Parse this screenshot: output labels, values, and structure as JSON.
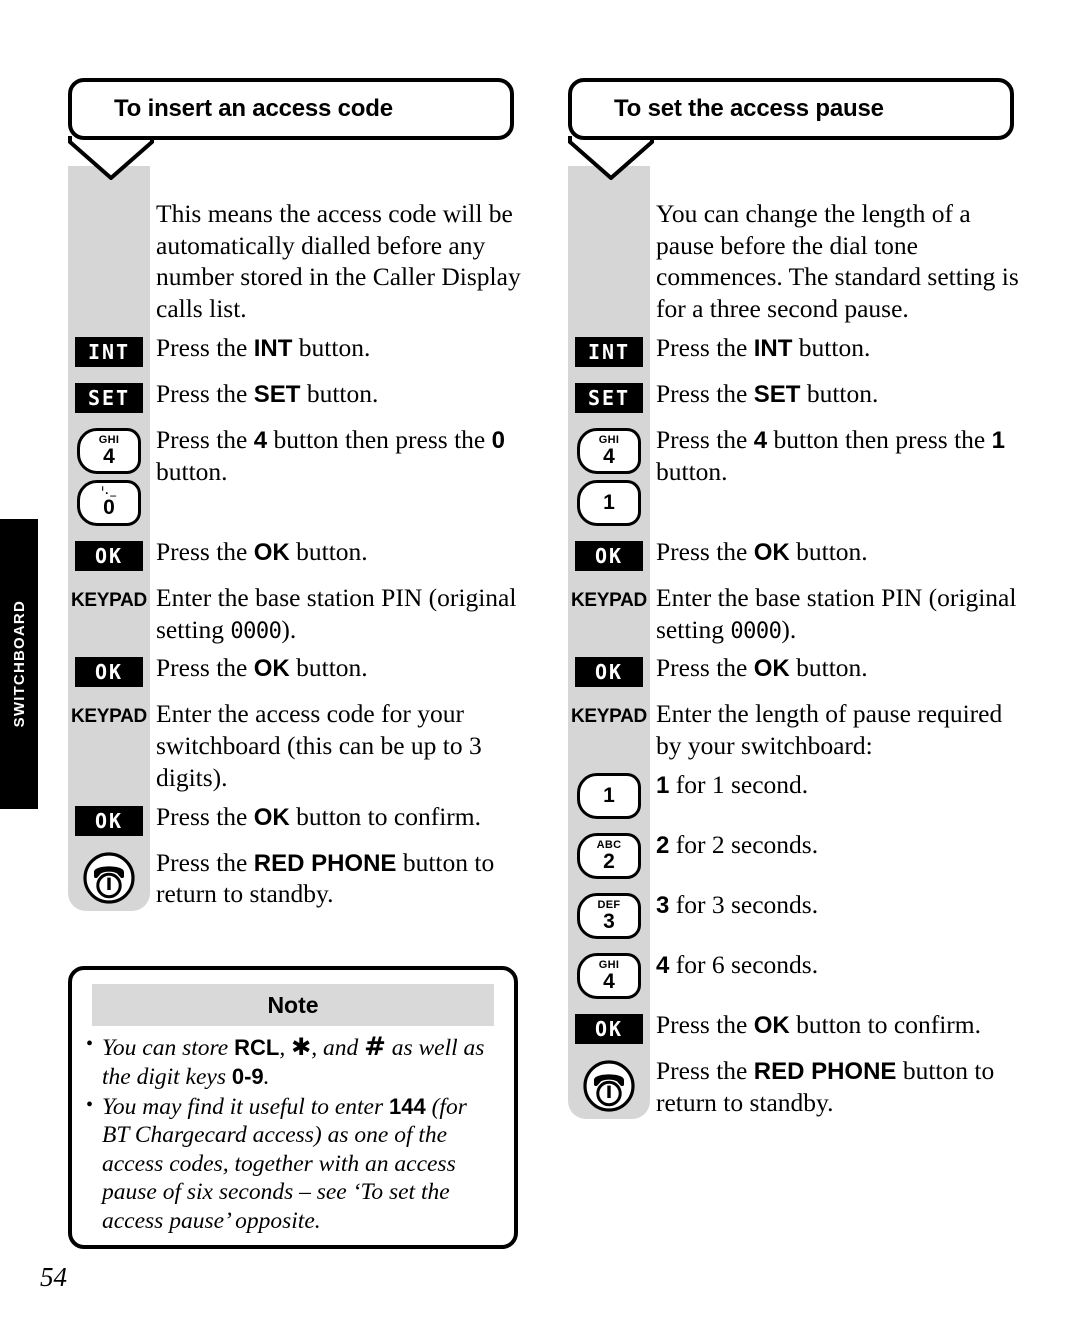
{
  "side_tab": {
    "label": "SWITCHBOARD"
  },
  "page_number": "54",
  "columns": [
    {
      "heading": "To insert an access code",
      "intro": "This means the access code will be automatically dialled before any number stored in the Caller Display calls list.",
      "steps": [
        {
          "icon": "int-button-icon",
          "icon_label": "INT",
          "text_prefix": "Press the ",
          "bold": "INT",
          "text_suffix": " button."
        },
        {
          "icon": "set-button-icon",
          "icon_label": "SET",
          "text_prefix": "Press the ",
          "bold": "SET",
          "text_suffix": " button."
        },
        {
          "icon": "keypad-4-then-0",
          "keys": [
            {
              "sub": "GHI",
              "num": "4"
            },
            {
              "sub": "ᑊ._",
              "num": "0",
              "sub_is_symbol": true
            }
          ],
          "text_prefix": "Press the ",
          "bold": "4",
          "text_mid": " button then press the ",
          "bold2": "0",
          "text_suffix": " button."
        },
        {
          "icon": "ok-button-icon",
          "icon_label": "OK",
          "text_prefix": "Press the ",
          "bold": "OK",
          "text_suffix": " button."
        },
        {
          "icon": "keypad-label",
          "icon_label": "KEYPAD",
          "text_prefix": "Enter the base station PIN (original setting ",
          "mono": "0000",
          "text_suffix": ")."
        },
        {
          "icon": "ok-button-icon",
          "icon_label": "OK",
          "text_prefix": "Press the ",
          "bold": "OK",
          "text_suffix": " button."
        },
        {
          "icon": "keypad-label",
          "icon_label": "KEYPAD",
          "text_prefix": "Enter the access code for your switchboard (this can be up to 3 digits)."
        },
        {
          "icon": "ok-button-icon",
          "icon_label": "OK",
          "text_prefix": "Press the ",
          "bold": "OK",
          "text_suffix": " button to confirm."
        },
        {
          "icon": "red-phone-icon",
          "text_prefix": "Press the ",
          "bold": "RED PHONE",
          "text_suffix": " button to return to standby."
        }
      ]
    },
    {
      "heading": "To set the access pause",
      "intro": "You can change the length of a pause before the dial tone commences. The standard setting is for a three second pause.",
      "steps": [
        {
          "icon": "int-button-icon",
          "icon_label": "INT",
          "text_prefix": "Press the ",
          "bold": "INT",
          "text_suffix": " button."
        },
        {
          "icon": "set-button-icon",
          "icon_label": "SET",
          "text_prefix": "Press the ",
          "bold": "SET",
          "text_suffix": " button."
        },
        {
          "icon": "keypad-4-then-1",
          "keys": [
            {
              "sub": "GHI",
              "num": "4"
            },
            {
              "sub": "",
              "num": "1"
            }
          ],
          "text_prefix": "Press the ",
          "bold": "4",
          "text_mid": " button then press the ",
          "bold2": "1",
          "text_suffix": " button."
        },
        {
          "icon": "ok-button-icon",
          "icon_label": "OK",
          "text_prefix": "Press the ",
          "bold": "OK",
          "text_suffix": " button."
        },
        {
          "icon": "keypad-label",
          "icon_label": "KEYPAD",
          "text_prefix": "Enter the base station PIN (original setting ",
          "mono": "0000",
          "text_suffix": ")."
        },
        {
          "icon": "ok-button-icon",
          "icon_label": "OK",
          "text_prefix": "Press the ",
          "bold": "OK",
          "text_suffix": " button."
        },
        {
          "icon": "keypad-label",
          "icon_label": "KEYPAD",
          "text_prefix": "Enter the length of pause required by your switchboard:"
        },
        {
          "icon": "keypad-1",
          "keys": [
            {
              "sub": "",
              "num": "1"
            }
          ],
          "bold": "1",
          "text_suffix": " for 1 second."
        },
        {
          "icon": "keypad-2",
          "keys": [
            {
              "sub": "ABC",
              "num": "2"
            }
          ],
          "bold": "2",
          "text_suffix": " for 2 seconds."
        },
        {
          "icon": "keypad-3",
          "keys": [
            {
              "sub": "DEF",
              "num": "3"
            }
          ],
          "bold": "3",
          "text_suffix": " for 3 seconds."
        },
        {
          "icon": "keypad-4",
          "keys": [
            {
              "sub": "GHI",
              "num": "4"
            }
          ],
          "bold": "4",
          "text_suffix": " for 6 seconds."
        },
        {
          "icon": "ok-button-icon",
          "icon_label": "OK",
          "text_prefix": "Press the ",
          "bold": "OK",
          "text_suffix": " button to confirm."
        },
        {
          "icon": "red-phone-icon",
          "text_prefix": "Press the ",
          "bold": "RED PHONE",
          "text_suffix": " button to return to standby."
        }
      ]
    }
  ],
  "note": {
    "title": "Note",
    "bullets": [
      {
        "parts": [
          {
            "t": "You can store ",
            "s": "i"
          },
          {
            "t": "RCL",
            "s": "b"
          },
          {
            "t": ", ",
            "s": "i"
          },
          {
            "t": "✱",
            "s": "star"
          },
          {
            "t": ", and ",
            "s": "i"
          },
          {
            "t": "#",
            "s": "hash"
          },
          {
            "t": " as well as the digit keys ",
            "s": "i"
          },
          {
            "t": "0-9",
            "s": "b"
          },
          {
            "t": ".",
            "s": "i"
          }
        ]
      },
      {
        "parts": [
          {
            "t": "You may find it useful to enter ",
            "s": "i"
          },
          {
            "t": "144",
            "s": "b"
          },
          {
            "t": " (for BT Chargecard access) as one of the access codes, together with an access pause of six seconds – see ‘To set the access pause’ opposite.",
            "s": "i"
          }
        ]
      }
    ]
  },
  "colors": {
    "band": "#d6d6d6",
    "note_header": "#d9d9d9",
    "ink": "#000000",
    "paper": "#ffffff"
  }
}
